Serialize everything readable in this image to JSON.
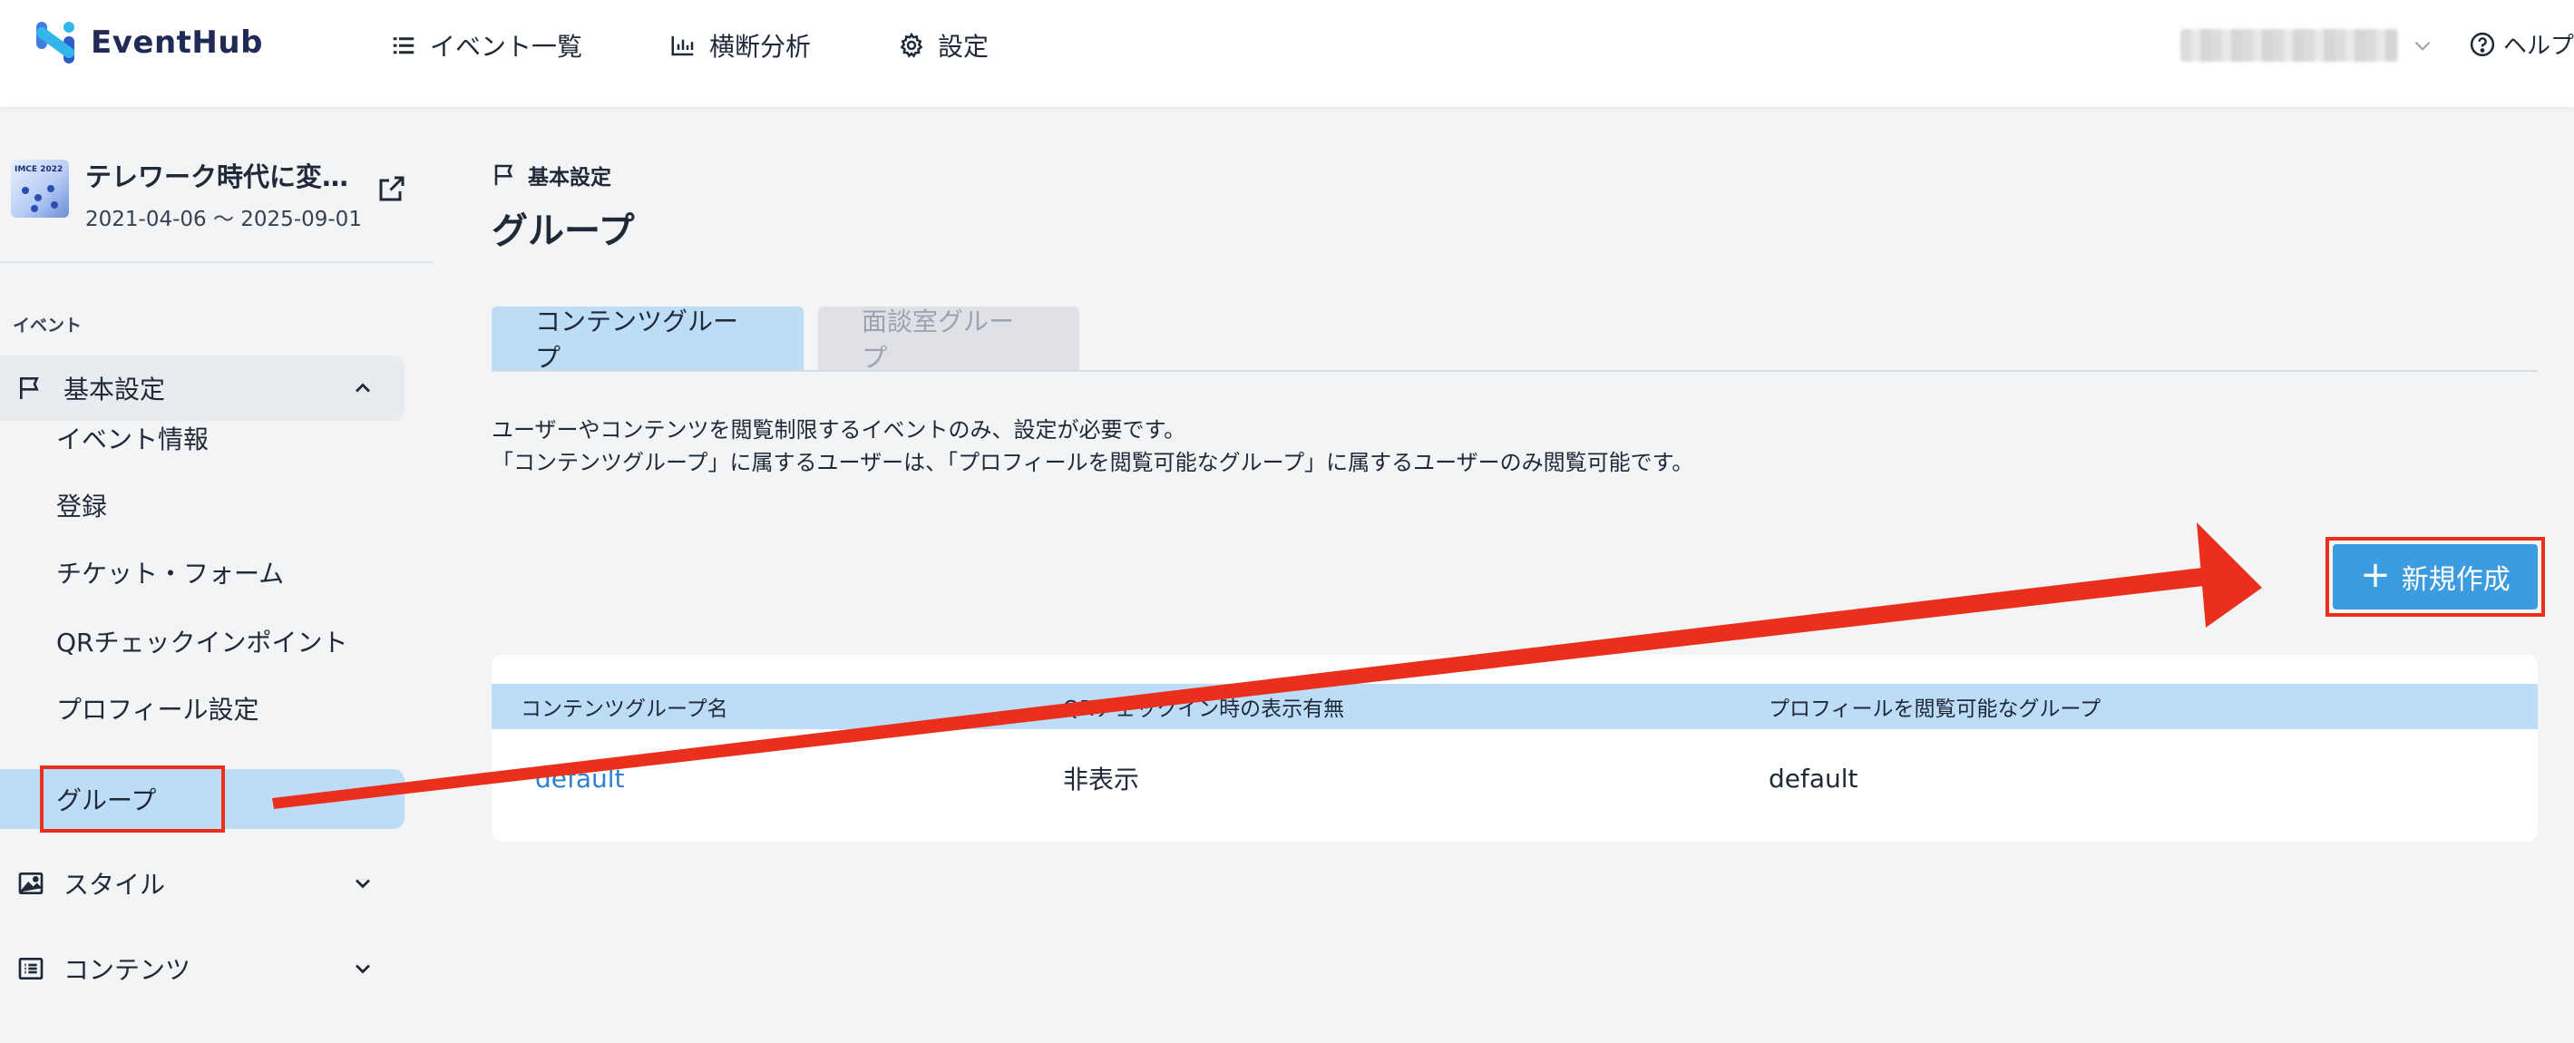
{
  "app": {
    "name": "EventHub"
  },
  "colors": {
    "accent": "#3d9be0",
    "tab_active": "#bcdcf7",
    "annotation": "#ea2f1c",
    "link": "#2f7fd1"
  },
  "nav": [
    {
      "label": "イベント一覧",
      "icon": "list-icon"
    },
    {
      "label": "横断分析",
      "icon": "bar-chart-icon"
    },
    {
      "label": "設定",
      "icon": "gear-icon"
    }
  ],
  "help": {
    "label": "ヘルプ"
  },
  "event": {
    "title": "テレワーク時代に変…",
    "dates": "2021-04-06 ～ 2025-09-01",
    "thumb_text": "IMCE 2022"
  },
  "sidebar": {
    "section": "イベント",
    "groups": [
      {
        "label": "基本設定",
        "icon": "flag-icon",
        "expanded": true
      },
      {
        "label": "スタイル",
        "icon": "image-icon",
        "expanded": false
      },
      {
        "label": "コンテンツ",
        "icon": "list-box-icon",
        "expanded": false
      }
    ],
    "sub_items": [
      "イベント情報",
      "登録",
      "チケット・フォーム",
      "QRチェックインポイント",
      "プロフィール設定",
      "グループ"
    ],
    "selected": "グループ"
  },
  "main": {
    "breadcrumb": "基本設定",
    "title": "グループ",
    "tabs": [
      {
        "label": "コンテンツグループ",
        "active": true
      },
      {
        "label": "面談室グループ",
        "active": false
      }
    ],
    "description": [
      "ユーザーやコンテンツを閲覧制限するイベントのみ、設定が必要です。",
      "「コンテンツグループ」に属するユーザーは、「プロフィールを閲覧可能なグループ」に属するユーザーのみ閲覧可能です。"
    ],
    "new_button": "新規作成",
    "table": {
      "columns": [
        "コンテンツグループ名",
        "QRチェックイン時の表示有無",
        "プロフィールを閲覧可能なグループ"
      ],
      "rows": [
        [
          "default",
          "非表示",
          "default"
        ]
      ]
    }
  }
}
